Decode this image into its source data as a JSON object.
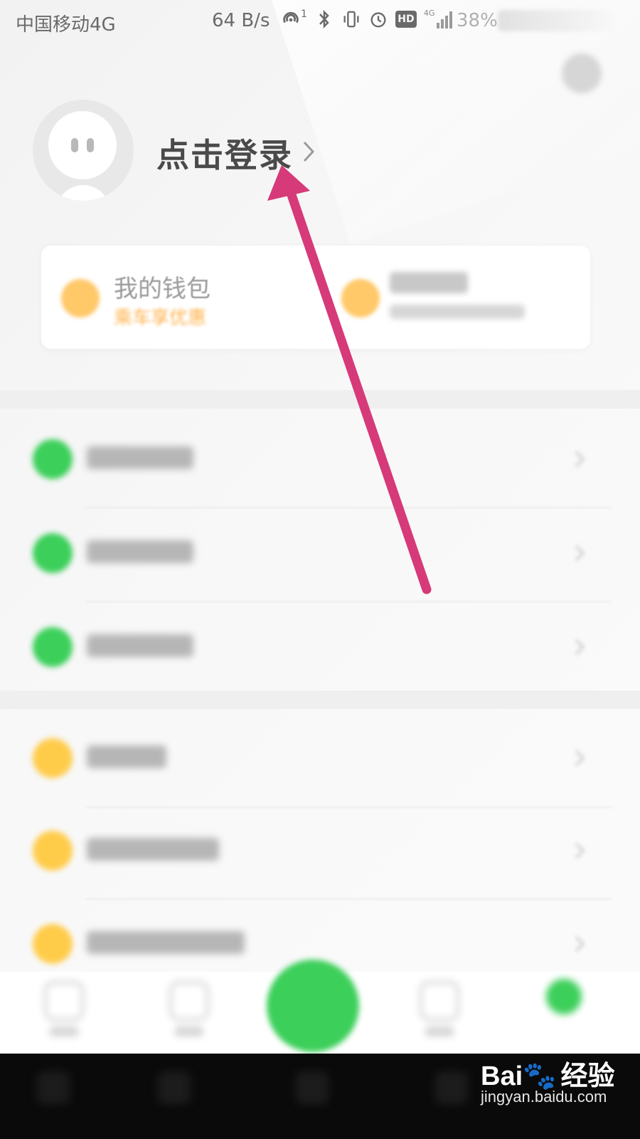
{
  "status_bar": {
    "carrier": "中国移动4G",
    "net_speed": "64 B/s",
    "battery_percent": "38%",
    "hotspot_count": "1",
    "hd_badge": "HD",
    "network_badge": "4G",
    "icons": [
      "hotspot-icon",
      "bluetooth-icon",
      "vibrate-icon",
      "alarm-icon",
      "hd-icon",
      "signal-icon"
    ]
  },
  "profile": {
    "login_label": "点击登录",
    "chevron": "›"
  },
  "wallet": {
    "title": "我的钱包",
    "subtitle": "乘车享优惠"
  },
  "menu": {
    "items": [
      {
        "icon_color": "#3ccf5a"
      },
      {
        "icon_color": "#3ccf5a"
      },
      {
        "icon_color": "#3ccf5a"
      },
      {
        "icon_color": "#ffcc4a"
      },
      {
        "icon_color": "#ffcc4a"
      },
      {
        "icon_color": "#ffcc4a"
      }
    ]
  },
  "watermark": {
    "brand_left": "Bai",
    "brand_right": "经验",
    "url": "jingyan.baidu.com"
  },
  "colors": {
    "annotation_arrow": "#d63a78",
    "accent_green": "#3ccf5a",
    "accent_orange": "#ffb24d"
  }
}
